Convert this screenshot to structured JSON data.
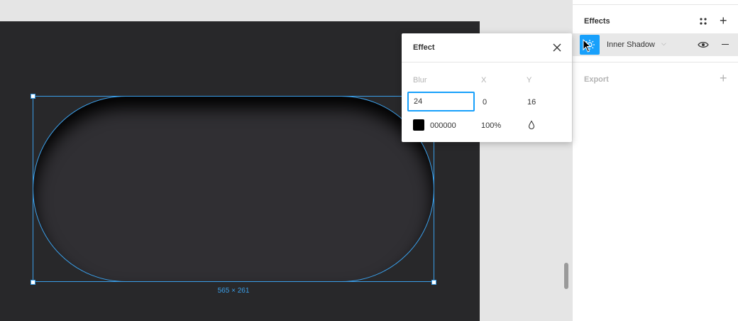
{
  "canvas": {
    "selection_dimensions": "565 × 261",
    "frame_color": "#28282a",
    "shape_color": "#302f33",
    "selection_color": "#3a9ee8"
  },
  "panel": {
    "effects_title": "Effects",
    "effect_type": "Inner Shadow",
    "export_title": "Export",
    "accent": "#18a0fb"
  },
  "popup": {
    "title": "Effect",
    "blur_label": "Blur",
    "x_label": "X",
    "y_label": "Y",
    "blur_value": "24",
    "x_value": "0",
    "y_value": "16",
    "color_hex": "000000",
    "opacity": "100%"
  }
}
